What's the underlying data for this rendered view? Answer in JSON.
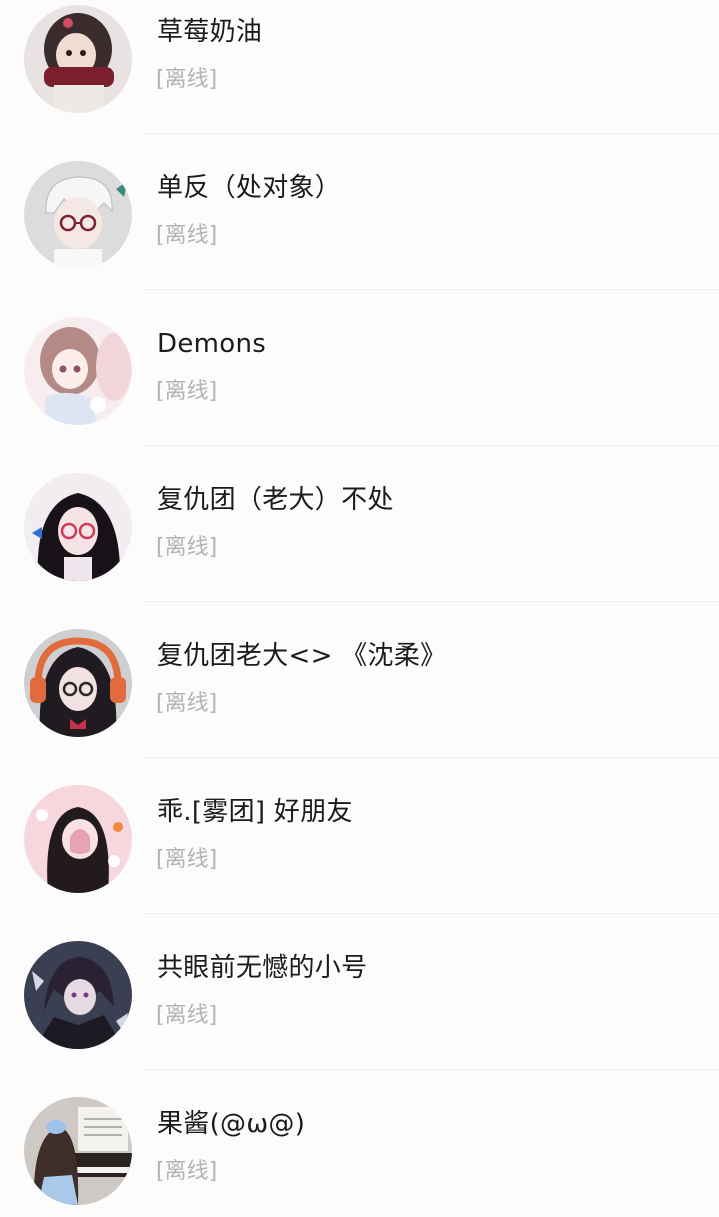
{
  "contacts": [
    {
      "name": "草莓奶油",
      "status": "[离线]",
      "avatar": "avatar-girl-red-scarf"
    },
    {
      "name": "单反（处对象）",
      "status": "[离线]",
      "avatar": "avatar-white-hair-glasses"
    },
    {
      "name": "Demons",
      "status": "[离线]",
      "avatar": "avatar-anime-girls-pink"
    },
    {
      "name": "复仇团（老大）不处",
      "status": "[离线]",
      "avatar": "avatar-black-hair-glasses"
    },
    {
      "name": "复仇团老大<> 《沈柔》",
      "status": "[离线]",
      "avatar": "avatar-headphones-girl"
    },
    {
      "name": "乖.[雾团]   好朋友",
      "status": "[离线]",
      "avatar": "avatar-pink-twin-tails"
    },
    {
      "name": "共眼前无憾的小号",
      "status": "[离线]",
      "avatar": "avatar-dark-anime-boy"
    },
    {
      "name": "果酱(@ω@)",
      "status": "[离线]",
      "avatar": "avatar-piano-girl"
    }
  ],
  "colors": {
    "background": "#fdfcfd",
    "name_text": "#1b1b1b",
    "status_text": "#b3b3b5",
    "divider": "#ecebed"
  }
}
